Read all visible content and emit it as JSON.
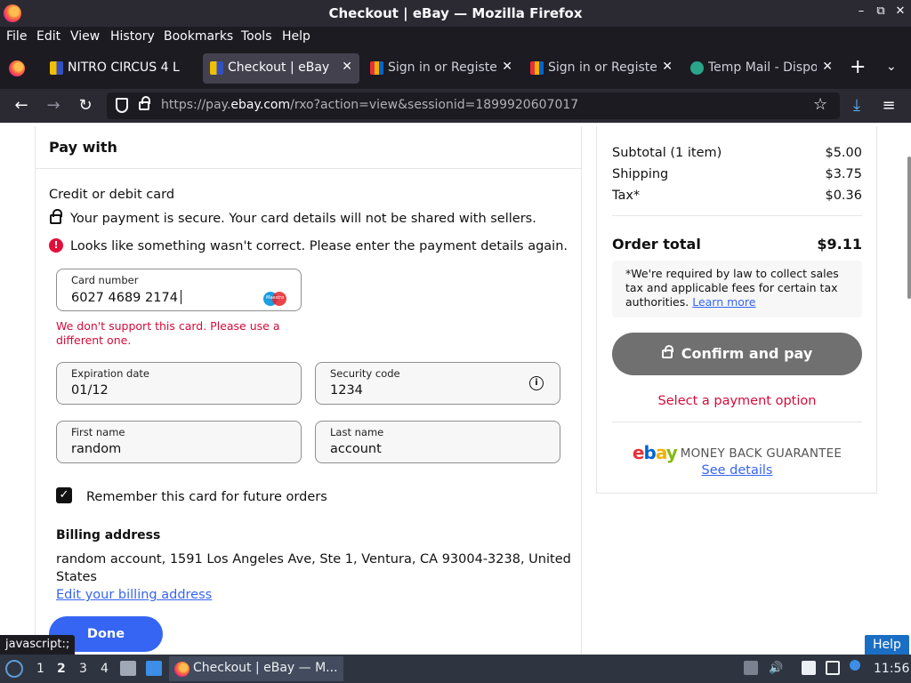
{
  "window": {
    "title": "Checkout | eBay — Mozilla Firefox",
    "controls": [
      "–",
      "⧉",
      "✕"
    ]
  },
  "menubar": [
    "File",
    "Edit",
    "View",
    "History",
    "Bookmarks",
    "Tools",
    "Help"
  ],
  "tabs": [
    {
      "label": "NITRO CIRCUS 4 L",
      "active": false
    },
    {
      "label": "Checkout | eBay",
      "active": true
    },
    {
      "label": "Sign in or Register",
      "active": false
    },
    {
      "label": "Sign in or Register",
      "active": false
    },
    {
      "label": "Temp Mail - Dispos",
      "active": false
    }
  ],
  "navbar": {
    "url_prefix": "https://pay.",
    "url_domain": "ebay.com",
    "url_rest": "/rxo?action=view&sessionid=1899920607017"
  },
  "pay": {
    "heading": "Pay with",
    "method": "Credit or debit card",
    "secure_note": "Your payment is secure. Your card details will not be shared with sellers.",
    "error_note": "Looks like something wasn't correct. Please enter the payment details again.",
    "card_number": {
      "label": "Card number",
      "value": "6027 4689 2174"
    },
    "card_brand": "Maestro",
    "card_error_line1": "We don't support this card. Please use a",
    "card_error_line2": "different one.",
    "expiration": {
      "label": "Expiration date",
      "value": "01/12"
    },
    "security": {
      "label": "Security code",
      "value": "1234"
    },
    "first_name": {
      "label": "First name",
      "value": "random"
    },
    "last_name": {
      "label": "Last name",
      "value": "account"
    },
    "remember": "Remember this card for future orders",
    "remember_checked": true,
    "billing_heading": "Billing address",
    "billing_line1": "random account, 1591 Los Angeles Ave, Ste 1, Ventura, CA 93004-3238, United",
    "billing_line2": "States",
    "edit_billing": "Edit your billing address",
    "done": "Done"
  },
  "summary": {
    "subtotal_label": "Subtotal (1 item)",
    "subtotal_value": "$5.00",
    "shipping_label": "Shipping",
    "shipping_value": "$3.75",
    "tax_label": "Tax*",
    "tax_value": "$0.36",
    "total_label": "Order total",
    "total_value": "$9.11",
    "tax_note": "*We're required by law to collect sales tax and applicable fees for certain tax authorities.",
    "learn_more": "Learn more",
    "confirm": "Confirm and pay",
    "select_option": "Select a payment option",
    "mbg": "MONEY BACK GUARANTEE",
    "see_details": "See details"
  },
  "status_link": "javascript:;",
  "help": "Help",
  "taskbar": {
    "workspaces": [
      "1",
      "2",
      "3",
      "4"
    ],
    "active_workspace": "2",
    "task_label": "Checkout | eBay — M...",
    "clock": "11:56"
  },
  "colors": {
    "accent": "#3665f3",
    "error": "#d50b3a",
    "confirm_disabled": "#707070"
  }
}
